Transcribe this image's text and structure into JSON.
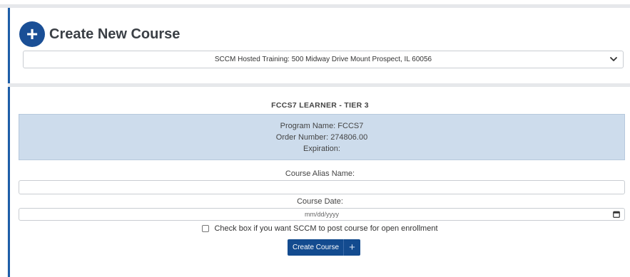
{
  "header": {
    "title": "Create New Course",
    "plus_glyph": "+",
    "location_select": {
      "selected": "SCCM Hosted Training: 500 Midway Drive Mount Prospect, IL 60056"
    }
  },
  "program": {
    "title": "FCCS7 LEARNER - TIER 3",
    "name_line": "Program Name: FCCS7",
    "order_line": "Order Number: 274806.00",
    "expiration_line": "Expiration:"
  },
  "form": {
    "alias_label": "Course Alias Name:",
    "alias_value": "",
    "date_label": "Course Date:",
    "date_placeholder": "mm/dd/yyyy",
    "open_enrollment_label": "Check box if you want SCCM to post course for open enrollment",
    "open_enrollment_checked": false,
    "submit_label": "Create Course",
    "submit_icon": "plus-icon"
  },
  "colors": {
    "accent": "#1a4f96",
    "info_box": "#cddcec"
  }
}
